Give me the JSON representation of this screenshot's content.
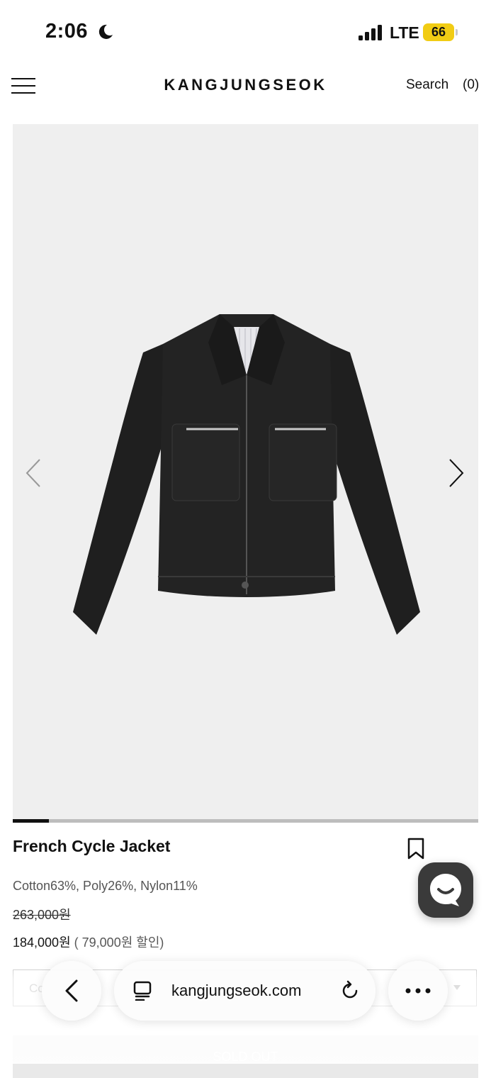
{
  "status_bar": {
    "time": "2:06",
    "network": "LTE",
    "battery": "66"
  },
  "header": {
    "brand": "KANGJUNGSEOK",
    "search_label": "Search",
    "cart_label": "(0)"
  },
  "gallery": {
    "progress": 0.077
  },
  "product": {
    "name": "French Cycle Jacket",
    "material": "Cotton63%, Poly26%, Nylon11%",
    "price_original": "263,000원",
    "price_sale": "184,000원",
    "discount": "( 79,000원 할인)"
  },
  "option": {
    "placeholder_visible": "Co"
  },
  "soldout": {
    "label": "SOLD OUT"
  },
  "browser": {
    "url": "kangjungseok.com"
  },
  "colors": {
    "accent_battery": "#f1cc14",
    "gallery_bg": "#efefef",
    "chat_button": "#3a3a3a"
  }
}
